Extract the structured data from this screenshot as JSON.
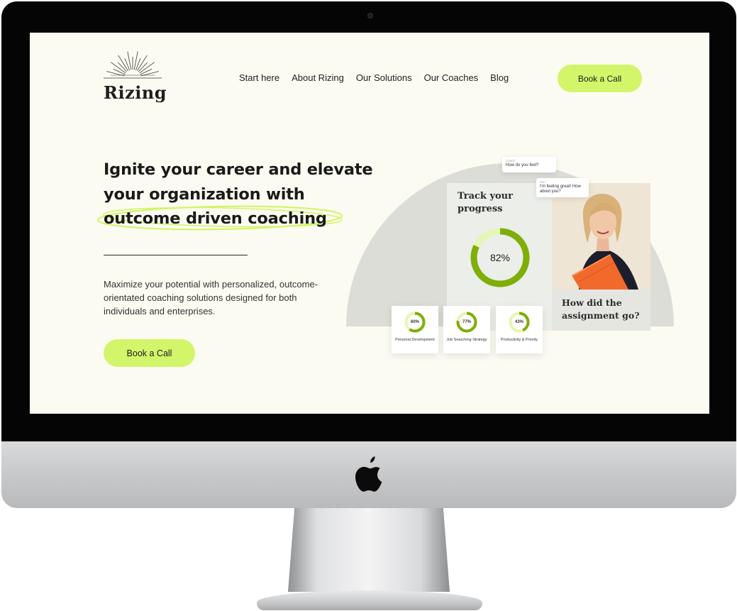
{
  "brand": {
    "name": "Rizing",
    "accent": "#d2f56a",
    "ring_color": "#7fae08",
    "ring_track": "#e4f7b3"
  },
  "nav": {
    "items": [
      {
        "label": "Start here"
      },
      {
        "label": "About Rizing"
      },
      {
        "label": "Our Solutions"
      },
      {
        "label": "Our Coaches"
      },
      {
        "label": "Blog"
      }
    ],
    "cta_label": "Book a Call"
  },
  "hero": {
    "title_line1": "Ignite your career and elevate",
    "title_line2": "your organization with",
    "title_highlight": "outcome driven coaching",
    "subtitle": "Maximize your potential with personalized, outcome-orientated coaching solutions designed for both individuals and enterprises.",
    "cta_label": "Book a Call"
  },
  "illustration": {
    "track_title": "Track your progress",
    "progress_value": 82,
    "progress_label": "82%",
    "photo_caption": "How did the assignment go?",
    "chat_question": {
      "from": "Coach",
      "message": "How do you feel?"
    },
    "chat_answer": {
      "from": "You",
      "message": "I'm feeling great! How about you?"
    },
    "mini_cards": [
      {
        "label": "Personal Development",
        "value": 60,
        "pct": "60%"
      },
      {
        "label": "Job Searching Strategy",
        "value": 77,
        "pct": "77%"
      },
      {
        "label": "Productivity & Priority",
        "value": 43,
        "pct": "43%"
      }
    ]
  },
  "icons": {
    "logo_mark": "sunrise-rays-icon",
    "device_logo": "apple-logo-icon"
  }
}
